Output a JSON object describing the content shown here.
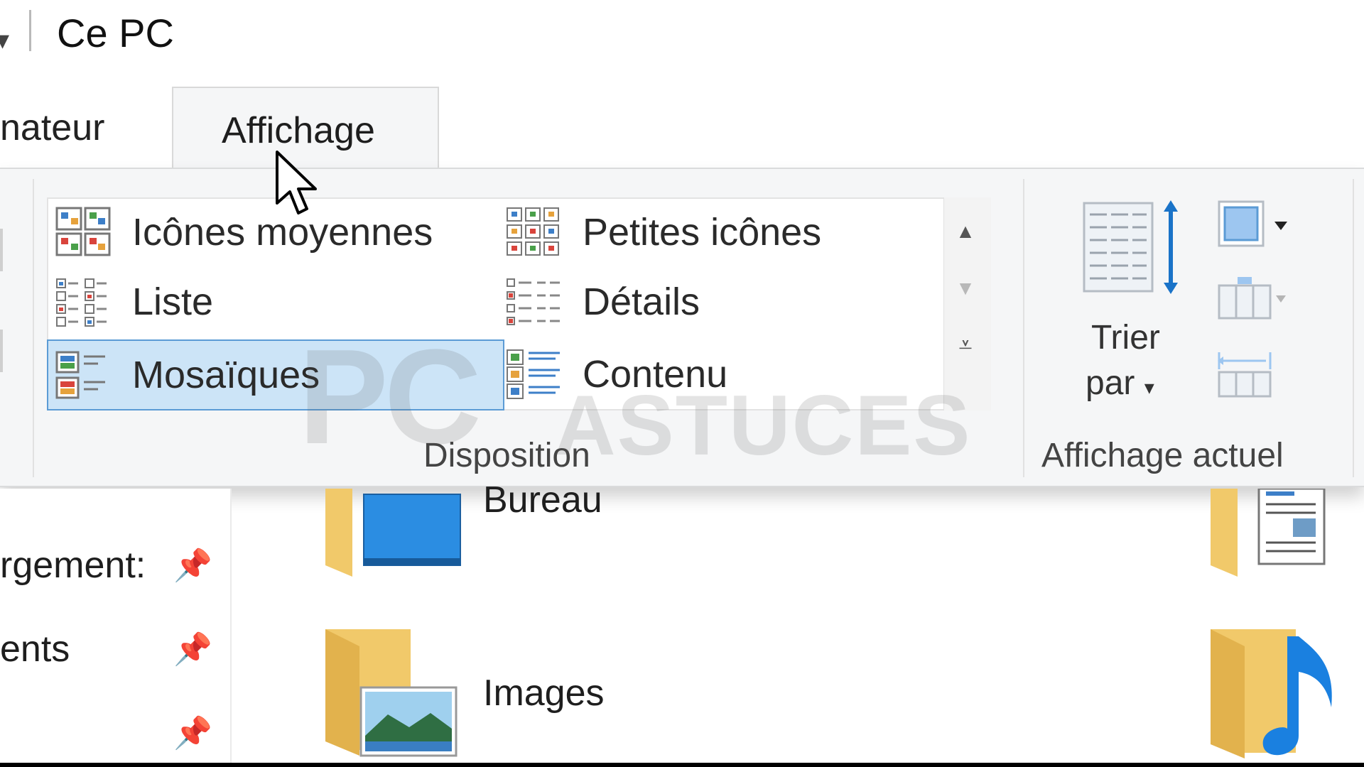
{
  "window": {
    "title": "Ce PC"
  },
  "tabs": {
    "partial_left": "nateur",
    "active": "Affichage"
  },
  "ribbon": {
    "disposition": {
      "group_label": "Disposition",
      "items": [
        {
          "label": "Icônes moyennes",
          "icon": "medium-icons-icon",
          "selected": false
        },
        {
          "label": "Petites icônes",
          "icon": "small-icons-icon",
          "selected": false
        },
        {
          "label": "Liste",
          "icon": "list-icon",
          "selected": false
        },
        {
          "label": "Détails",
          "icon": "details-icon",
          "selected": false
        },
        {
          "label": "Mosaïques",
          "icon": "tiles-icon",
          "selected": true
        },
        {
          "label": "Contenu",
          "icon": "content-icon",
          "selected": false
        }
      ]
    },
    "current_view": {
      "group_label": "Affichage actuel",
      "sort_line1": "Trier",
      "sort_line2": "par"
    }
  },
  "nav": {
    "items": [
      {
        "label": "rgement:",
        "pinned": true
      },
      {
        "label": "ents",
        "pinned": true
      },
      {
        "label": "",
        "pinned": true
      }
    ]
  },
  "folders": [
    {
      "name": "Bureau",
      "icon": "desktop-folder-icon"
    },
    {
      "name": "Images",
      "icon": "pictures-folder-icon"
    }
  ],
  "watermark": {
    "text1": "PC",
    "text2": "ASTUCES"
  },
  "colors": {
    "selection_bg": "#cce4f7",
    "selection_border": "#5b9bd5",
    "ribbon_bg": "#f5f6f7",
    "accent_blue": "#1a73c8"
  }
}
